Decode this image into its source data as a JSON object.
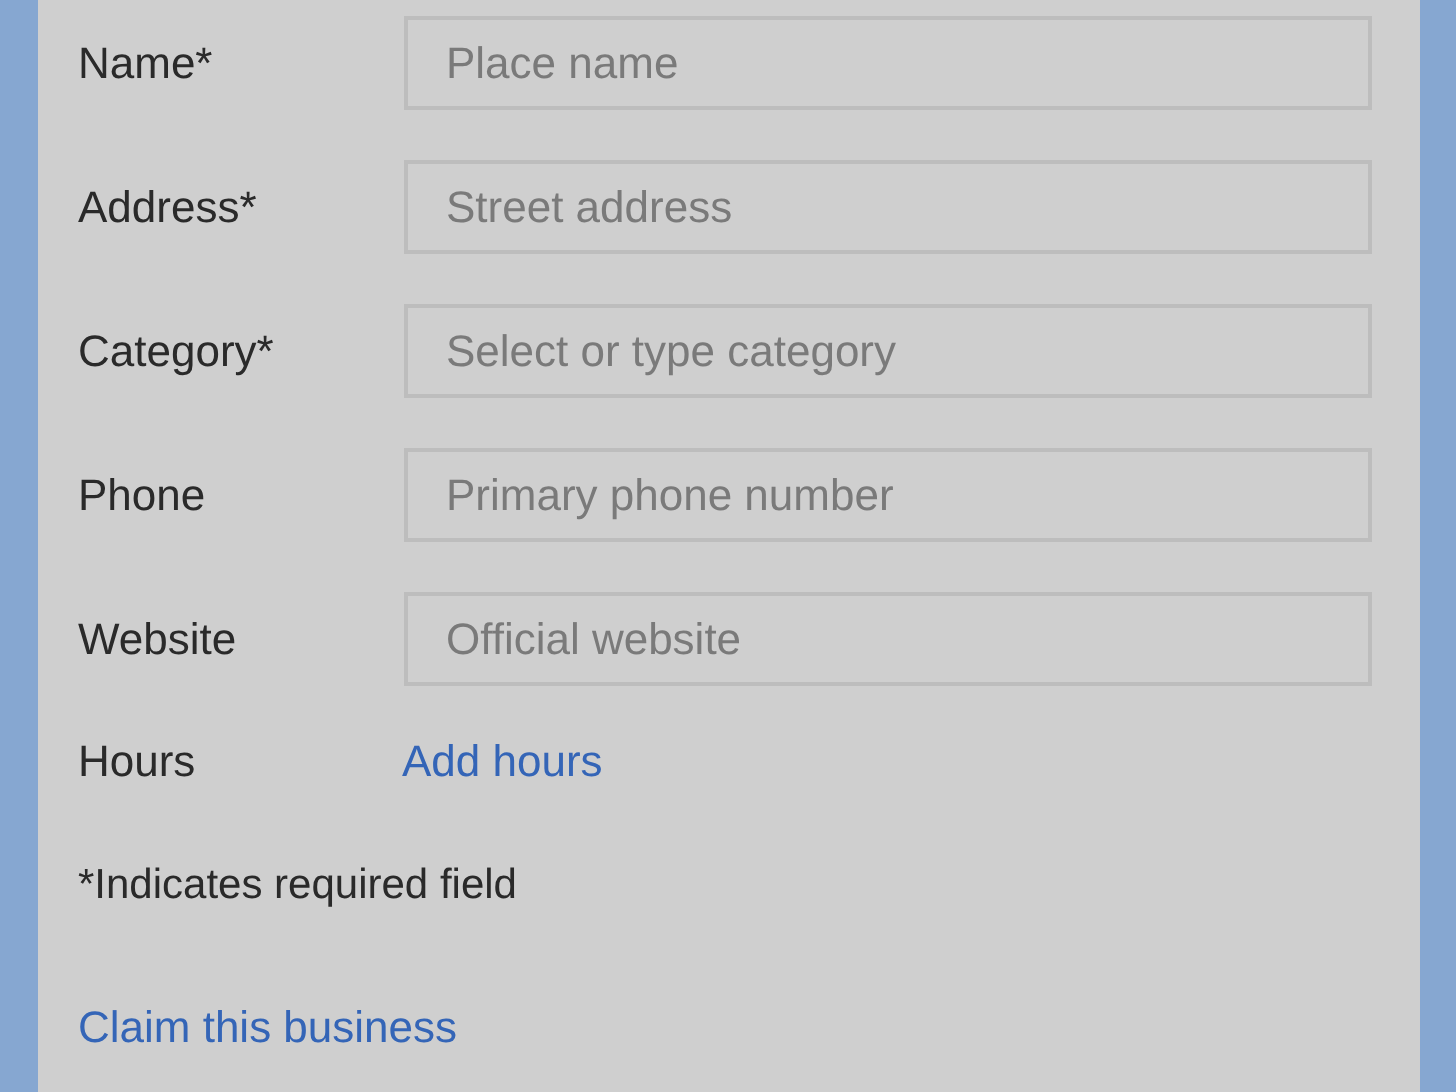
{
  "fields": [
    {
      "label": "Name*",
      "placeholder": "Place name"
    },
    {
      "label": "Address*",
      "placeholder": "Street address"
    },
    {
      "label": "Category*",
      "placeholder": "Select or type category"
    },
    {
      "label": "Phone",
      "placeholder": "Primary phone number"
    },
    {
      "label": "Website",
      "placeholder": "Official website"
    }
  ],
  "hours": {
    "label": "Hours",
    "link": "Add hours"
  },
  "note": "*Indicates required field",
  "claim_link": "Claim this business"
}
